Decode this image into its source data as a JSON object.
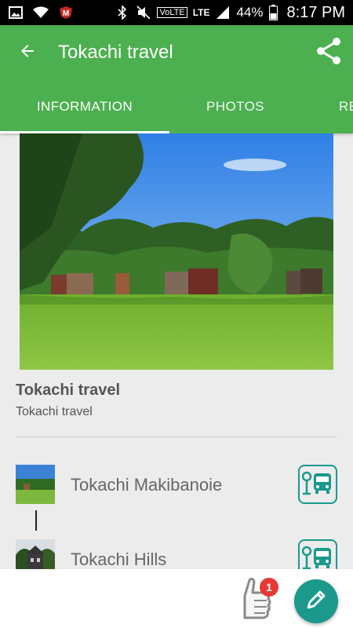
{
  "status_bar": {
    "battery_percent": "44%",
    "time": "8:17 PM",
    "network": "LTE",
    "volte": "VoLTE"
  },
  "header": {
    "title": "Tokachi travel",
    "back_icon": "arrow-back-icon",
    "share_icon": "share-icon"
  },
  "tabs": [
    {
      "label": "INFORMATION",
      "selected": true
    },
    {
      "label": "PHOTOS",
      "selected": false
    },
    {
      "label": "RE",
      "selected": false
    }
  ],
  "place": {
    "title": "Tokachi travel",
    "subtitle": "Tokachi travel"
  },
  "route": [
    {
      "name": "Tokachi Makibanoie",
      "icon": "bus-stop-icon"
    },
    {
      "name": "Tokachi Hills",
      "icon": "bus-stop-icon"
    }
  ],
  "actions": {
    "like_badge_count": "1",
    "like_icon": "thumbs-up-icon",
    "edit_icon": "pencil-icon"
  },
  "colors": {
    "primary": "#4caf50",
    "accent": "#1b998b",
    "badge": "#e53935"
  }
}
